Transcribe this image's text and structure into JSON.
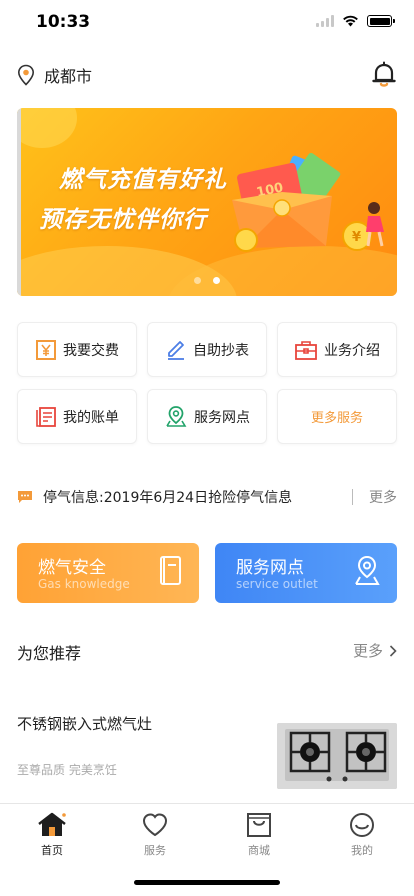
{
  "status_bar": {
    "time": "10:33"
  },
  "header": {
    "city": "成都市"
  },
  "banner": {
    "line1": "燃气充值有好礼",
    "line2": "预存无忧伴你行",
    "ticket_text": "100",
    "coin_text": "¥",
    "slide_count": 2,
    "active_slide": 2
  },
  "services": {
    "pay": "我要交费",
    "self_read": "自助抄表",
    "business": "业务介绍",
    "bill": "我的账单",
    "outlet": "服务网点",
    "more": "更多服务"
  },
  "notice": {
    "text": "停气信息:2019年6月24日抢险停气信息",
    "more": "更多"
  },
  "cards": {
    "safety": {
      "title": "燃气安全",
      "subtitle": "Gas knowledge"
    },
    "outlet": {
      "title": "服务网点",
      "subtitle": "service outlet"
    }
  },
  "recommend": {
    "title": "为您推荐",
    "more": "更多",
    "product": {
      "name": "不锈钢嵌入式燃气灶",
      "desc": "至尊品质 完美烹饪"
    }
  },
  "tabbar": {
    "home": "首页",
    "service": "服务",
    "mall": "商城",
    "mine": "我的"
  },
  "colors": {
    "accent_orange": "#f39a3a",
    "banner_orange": "#ffa514",
    "card_blue": "#3f86f5",
    "card_orange": "#ffa235"
  },
  "icons": {
    "location": "location-pin-icon",
    "bell": "bell-icon",
    "pay": "yen-bill-icon",
    "self_read": "pencil-icon",
    "business": "briefcase-icon",
    "bill": "bill-list-icon",
    "outlet": "map-pin-icon",
    "notice": "message-icon",
    "safety": "book-icon",
    "outlet_card": "outlet-pin-icon",
    "home": "home-icon",
    "service": "heart-icon",
    "mall": "shopping-bag-icon",
    "mine": "smile-icon"
  }
}
